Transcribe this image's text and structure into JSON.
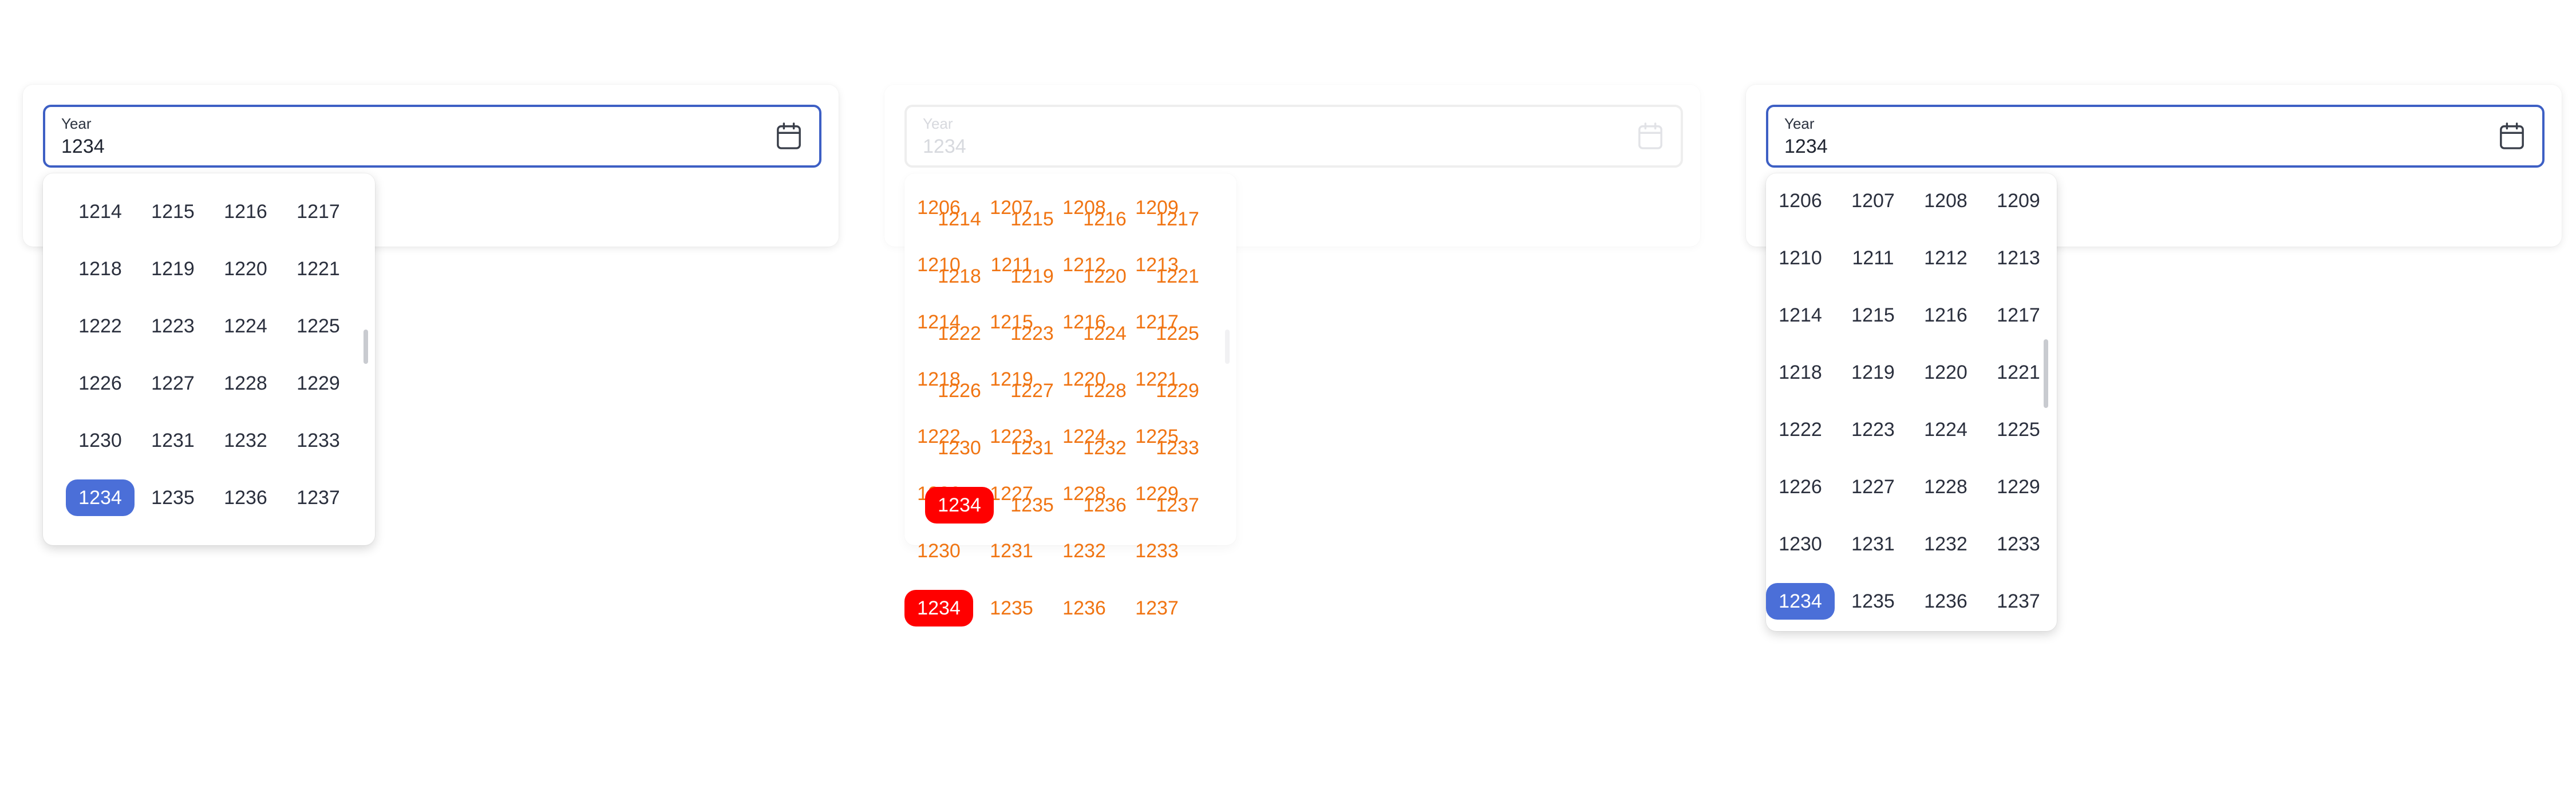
{
  "panels": [
    {
      "id": "left",
      "state": "active",
      "field": {
        "label": "Year",
        "value": "1234"
      },
      "dropdown": {
        "rows": [
          [
            "1214",
            "1215",
            "1216",
            "1217"
          ],
          [
            "1218",
            "1219",
            "1220",
            "1221"
          ],
          [
            "1222",
            "1223",
            "1224",
            "1225"
          ],
          [
            "1226",
            "1227",
            "1228",
            "1229"
          ],
          [
            "1230",
            "1231",
            "1232",
            "1233"
          ],
          [
            "1234",
            "1235",
            "1236",
            "1237"
          ]
        ],
        "selected": "1234"
      }
    },
    {
      "id": "middle",
      "state": "disabled",
      "field": {
        "label": "Year",
        "value": "1234"
      },
      "overlay_layer_a": {
        "rows": [
          [
            "1206",
            "1207",
            "1208",
            "1209"
          ],
          [
            "1210",
            "1211",
            "1212",
            "1213"
          ],
          [
            "1214",
            "1215",
            "1216",
            "1217"
          ],
          [
            "1218",
            "1219",
            "1220",
            "1221"
          ],
          [
            "1222",
            "1223",
            "1224",
            "1225"
          ],
          [
            "1226",
            "1227",
            "1228",
            "1229"
          ],
          [
            "1230",
            "1231",
            "1232",
            "1233"
          ],
          [
            "1234",
            "1235",
            "1236",
            "1237"
          ]
        ],
        "selected": "1234"
      },
      "overlay_layer_b": {
        "rows": [
          [
            "1214",
            "1215",
            "1216",
            "1217"
          ],
          [
            "1218",
            "1219",
            "1220",
            "1221"
          ],
          [
            "1222",
            "1223",
            "1224",
            "1225"
          ],
          [
            "1226",
            "1227",
            "1228",
            "1229"
          ],
          [
            "1230",
            "1231",
            "1232",
            "1233"
          ],
          [
            "1234",
            "1235",
            "1236",
            "1237"
          ]
        ],
        "selected": "1234"
      }
    },
    {
      "id": "right",
      "state": "active",
      "field": {
        "label": "Year",
        "value": "1234"
      },
      "dropdown": {
        "rows": [
          [
            "1206",
            "1207",
            "1208",
            "1209"
          ],
          [
            "1210",
            "1211",
            "1212",
            "1213"
          ],
          [
            "1214",
            "1215",
            "1216",
            "1217"
          ],
          [
            "1218",
            "1219",
            "1220",
            "1221"
          ],
          [
            "1222",
            "1223",
            "1224",
            "1225"
          ],
          [
            "1226",
            "1227",
            "1228",
            "1229"
          ],
          [
            "1230",
            "1231",
            "1232",
            "1233"
          ],
          [
            "1234",
            "1235",
            "1236",
            "1237"
          ]
        ],
        "selected": "1234"
      }
    }
  ],
  "colors": {
    "accent": "#3d5fc4",
    "selected_cell": "#4b6fd8",
    "overlay_text": "#f07412",
    "overlay_selected": "#ff0000",
    "disabled_text": "#d7d9de"
  },
  "icons": {
    "field_icon": "calendar-icon"
  }
}
